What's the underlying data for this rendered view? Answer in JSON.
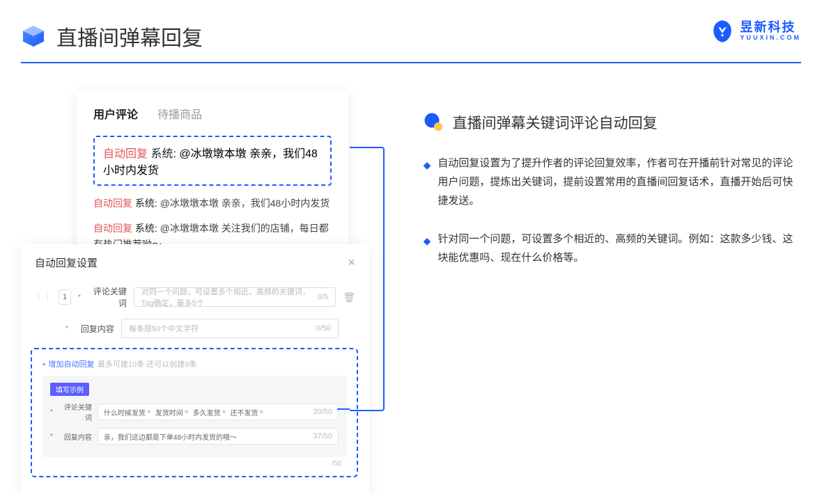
{
  "header": {
    "title": "直播间弹幕回复"
  },
  "brand": {
    "cn": "昱新科技",
    "en": "YUUXIN.COM"
  },
  "comments": {
    "tab_active": "用户评论",
    "tab_inactive": "待播商品",
    "boxed": {
      "auto": "自动回复",
      "sys": "系统:",
      "msg": "@冰墩墩本墩 亲亲，我们48小时内发货"
    },
    "line2": {
      "auto": "自动回复",
      "sys": "系统:",
      "msg": "@冰墩墩本墩 亲亲，我们48小时内发货"
    },
    "line3": {
      "auto": "自动回复",
      "sys": "系统:",
      "msg": "@冰墩墩本墩 关注我们的店铺，每日都有热门推荐呦～"
    }
  },
  "settings": {
    "title": "自动回复设置",
    "row_num": "1",
    "kw_label": "评论关键词",
    "kw_placeholder": "对同一个问题，可设置多个相近、高频的关键词，Tag确定，最多5个",
    "kw_count": "0/5",
    "rc_label": "回复内容",
    "rc_placeholder": "每条限50个中文字符",
    "rc_count": "0/50"
  },
  "example": {
    "add_link": "+ 增加自动回复",
    "add_hint": "最多可建10条 还可以创建9条",
    "badge": "填写示例",
    "kw_label": "评论关键词",
    "tags": [
      "什么时候发货",
      "发货时间",
      "多久发货",
      "还不发货"
    ],
    "kw_count": "20/50",
    "rc_label": "回复内容",
    "rc_text": "亲，我们这边都是下单48小时内发货的哦～",
    "rc_count": "37/50",
    "rc_count2": "/50"
  },
  "right": {
    "title": "直播间弹幕关键词评论自动回复",
    "b1": "自动回复设置为了提升作者的评论回复效率，作者可在开播前针对常见的评论用户问题，提炼出关键词，提前设置常用的直播间回复话术，直播开始后可快捷发送。",
    "b2": "针对同一个问题，可设置多个相近的、高频的关键词。例如：这款多少钱、这块能优惠吗、现在什么价格等。"
  }
}
